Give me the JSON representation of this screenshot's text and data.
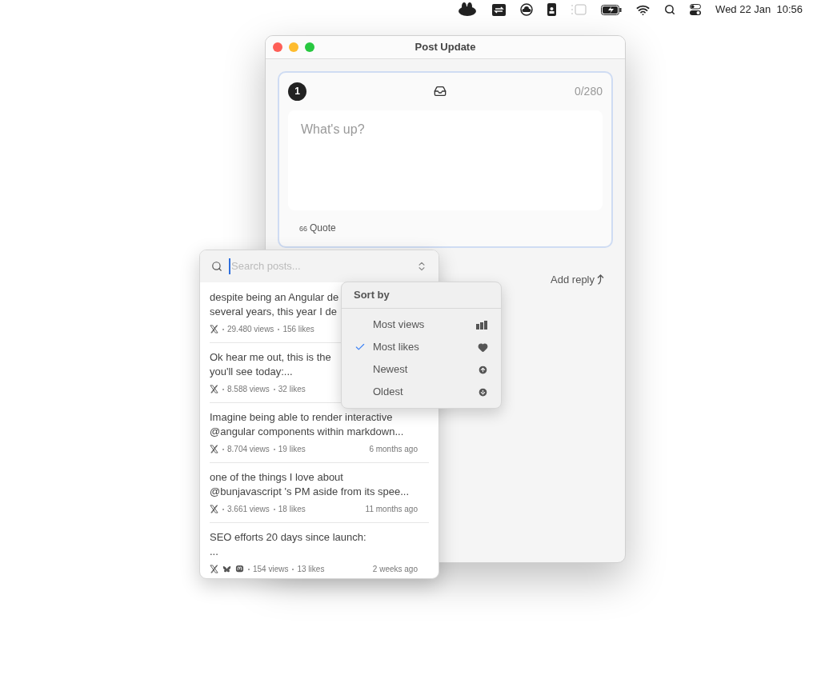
{
  "menu_bar": {
    "clock": "Wed 22 Jan  10:56"
  },
  "window": {
    "title": "Post Update"
  },
  "composer": {
    "thread_index": "1",
    "counter": "0/280",
    "placeholder": "What's up?",
    "quote_label": "Quote",
    "quote_mark": "66"
  },
  "add_reply": "Add reply",
  "search_popover": {
    "placeholder": "Search posts...",
    "posts": [
      {
        "lines": [
          "despite being an Angular de",
          "several years, this year I de"
        ],
        "cross_posted": false,
        "views": "29.480 views",
        "likes": "156 likes"
      },
      {
        "lines": [
          "Ok hear me out, this is the",
          "you'll see today:..."
        ],
        "cross_posted": false,
        "views": "8.588 views",
        "likes": "32 likes"
      },
      {
        "lines": [
          "Imagine being able to render interactive",
          "@angular components within markdown..."
        ],
        "cross_posted": false,
        "views": "8.704 views",
        "likes": "19 likes",
        "age": "6 months ago"
      },
      {
        "lines": [
          "one of the things I love about",
          "@bunjavascript 's PM aside from its spee..."
        ],
        "cross_posted": false,
        "views": "3.661 views",
        "likes": "18 likes",
        "age": "11 months ago"
      },
      {
        "lines": [
          "SEO efforts 20 days since launch:",
          "..."
        ],
        "cross_posted": true,
        "views": "154 views",
        "likes": "13 likes",
        "age": "2 weeks ago"
      }
    ]
  },
  "sort_menu": {
    "title": "Sort by",
    "options": [
      {
        "label": "Most views",
        "kind": "views",
        "selected": false
      },
      {
        "label": "Most likes",
        "kind": "likes",
        "selected": true
      },
      {
        "label": "Newest",
        "kind": "newest",
        "selected": false
      },
      {
        "label": "Oldest",
        "kind": "oldest",
        "selected": false
      }
    ]
  }
}
